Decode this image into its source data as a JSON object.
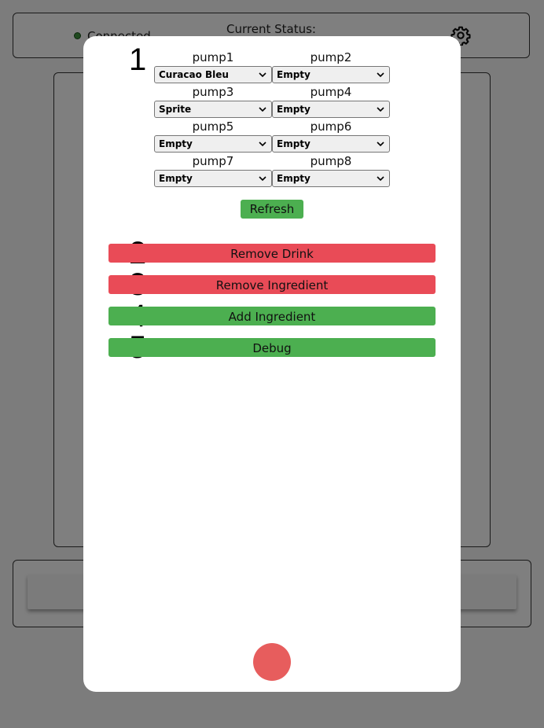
{
  "header": {
    "connection_label": "Connected",
    "status_label": "Current Status:"
  },
  "modal": {
    "steps": [
      "1",
      "2",
      "3",
      "4",
      "5"
    ],
    "pumps": [
      {
        "label": "pump1",
        "value": "Curacao Bleu"
      },
      {
        "label": "pump2",
        "value": "Empty"
      },
      {
        "label": "pump3",
        "value": "Sprite"
      },
      {
        "label": "pump4",
        "value": "Empty"
      },
      {
        "label": "pump5",
        "value": "Empty"
      },
      {
        "label": "pump6",
        "value": "Empty"
      },
      {
        "label": "pump7",
        "value": "Empty"
      },
      {
        "label": "pump8",
        "value": "Empty"
      }
    ],
    "refresh_label": "Refresh",
    "remove_drink_label": "Remove Drink",
    "remove_ingredient_label": "Remove Ingredient",
    "add_ingredient_label": "Add Ingredient",
    "debug_label": "Debug"
  },
  "colors": {
    "green": "#4caf50",
    "red": "#e94b57",
    "close": "#e75d5d"
  },
  "icons": {
    "settings": "gear-icon",
    "status": "status-dot-icon",
    "dropdown": "chevron-down-icon"
  }
}
